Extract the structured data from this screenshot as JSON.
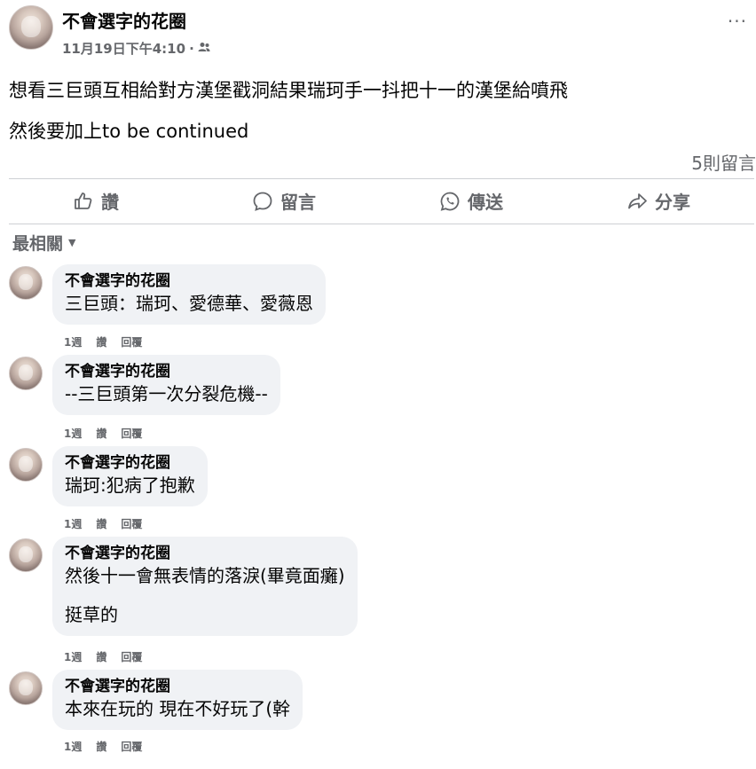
{
  "post": {
    "author": "不會選字的花圈",
    "timestamp": "11月19日下午4:10",
    "separator": "·",
    "audience_icon": "friends-icon",
    "more_label": "···",
    "text_lines": [
      "想看三巨頭互相給對方漢堡戳洞結果瑞珂手一抖把十一的漢堡給噴飛",
      "然後要加上to be continued"
    ],
    "comment_count": "5則留言"
  },
  "actions": [
    {
      "icon": "like-icon",
      "label": "讚"
    },
    {
      "icon": "comment-icon",
      "label": "留言"
    },
    {
      "icon": "whatsapp-icon",
      "label": "傳送"
    },
    {
      "icon": "share-icon",
      "label": "分享"
    }
  ],
  "sort": {
    "label": "最相關",
    "icon": "caret-down-icon"
  },
  "comments": [
    {
      "author": "不會選字的花圈",
      "lines": [
        "三巨頭：瑞珂、愛德華、愛薇恩"
      ],
      "time": "1週",
      "like": "讚",
      "reply": "回覆"
    },
    {
      "author": "不會選字的花圈",
      "lines": [
        "--三巨頭第一次分裂危機--"
      ],
      "time": "1週",
      "like": "讚",
      "reply": "回覆"
    },
    {
      "author": "不會選字的花圈",
      "lines": [
        "瑞珂:犯病了抱歉"
      ],
      "time": "1週",
      "like": "讚",
      "reply": "回覆"
    },
    {
      "author": "不會選字的花圈",
      "lines": [
        "然後十一會無表情的落淚(畢竟面癱)",
        "挺草的"
      ],
      "time": "1週",
      "like": "讚",
      "reply": "回覆"
    },
    {
      "author": "不會選字的花圈",
      "lines": [
        "本來在玩的 現在不好玩了(幹"
      ],
      "time": "1週",
      "like": "讚",
      "reply": "回覆"
    }
  ],
  "colors": {
    "secondary_text": "#65676b",
    "bubble_bg": "#f0f2f5",
    "divider": "#ced0d4"
  }
}
